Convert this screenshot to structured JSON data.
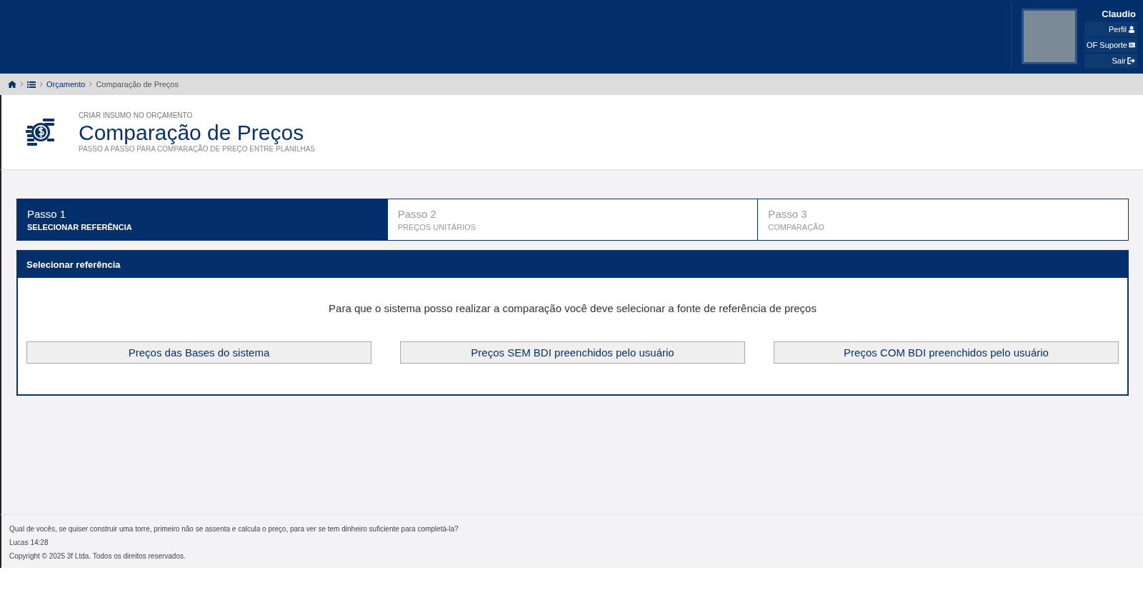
{
  "user": {
    "name": "Claudio",
    "menu": [
      {
        "label": "Perfil",
        "kind": "profile"
      },
      {
        "label": "OF Suporte",
        "kind": "support"
      },
      {
        "label": "Sair",
        "kind": "logout"
      }
    ]
  },
  "breadcrumb": [
    {
      "label": "Orçamento",
      "kind": "link"
    },
    {
      "label": "Comparação de Preços",
      "kind": "current"
    }
  ],
  "page_header": {
    "overline": "CRIAR INSUMO NO ORÇAMENTO",
    "title": "Comparação de Preços",
    "subtitle": "PASSO A PASSO PARA COMPARAÇÃO DE PREÇO ENTRE PLANILHAS"
  },
  "steps": [
    {
      "title": "Passo 1",
      "subtitle": "SELECIONAR REFERÊNCIA",
      "selected": true
    },
    {
      "title": "Passo 2",
      "subtitle": "PREÇOS UNITÁRIOS",
      "selected": false
    },
    {
      "title": "Passo 3",
      "subtitle": "COMPARAÇÃO",
      "selected": false
    }
  ],
  "panel": {
    "title": "Selecionar referência",
    "message": "Para que o sistema posso realizar a comparação você deve selecionar a fonte de referência de preços",
    "buttons": [
      "Preços das Bases do sistema",
      "Preços SEM BDI preenchidos pelo usuário",
      "Preços COM BDI preenchidos pelo usuário"
    ]
  },
  "footer": {
    "quote": "Qual de vocês, se quiser construir uma torre, primeiro não se assenta e calcula o preço, para ver se tem dinheiro suficiente para completá-la?",
    "reference": "Lucas 14:28",
    "copyright": "Copyright © 2025 3f Ltda. Todos os direitos reservados."
  }
}
